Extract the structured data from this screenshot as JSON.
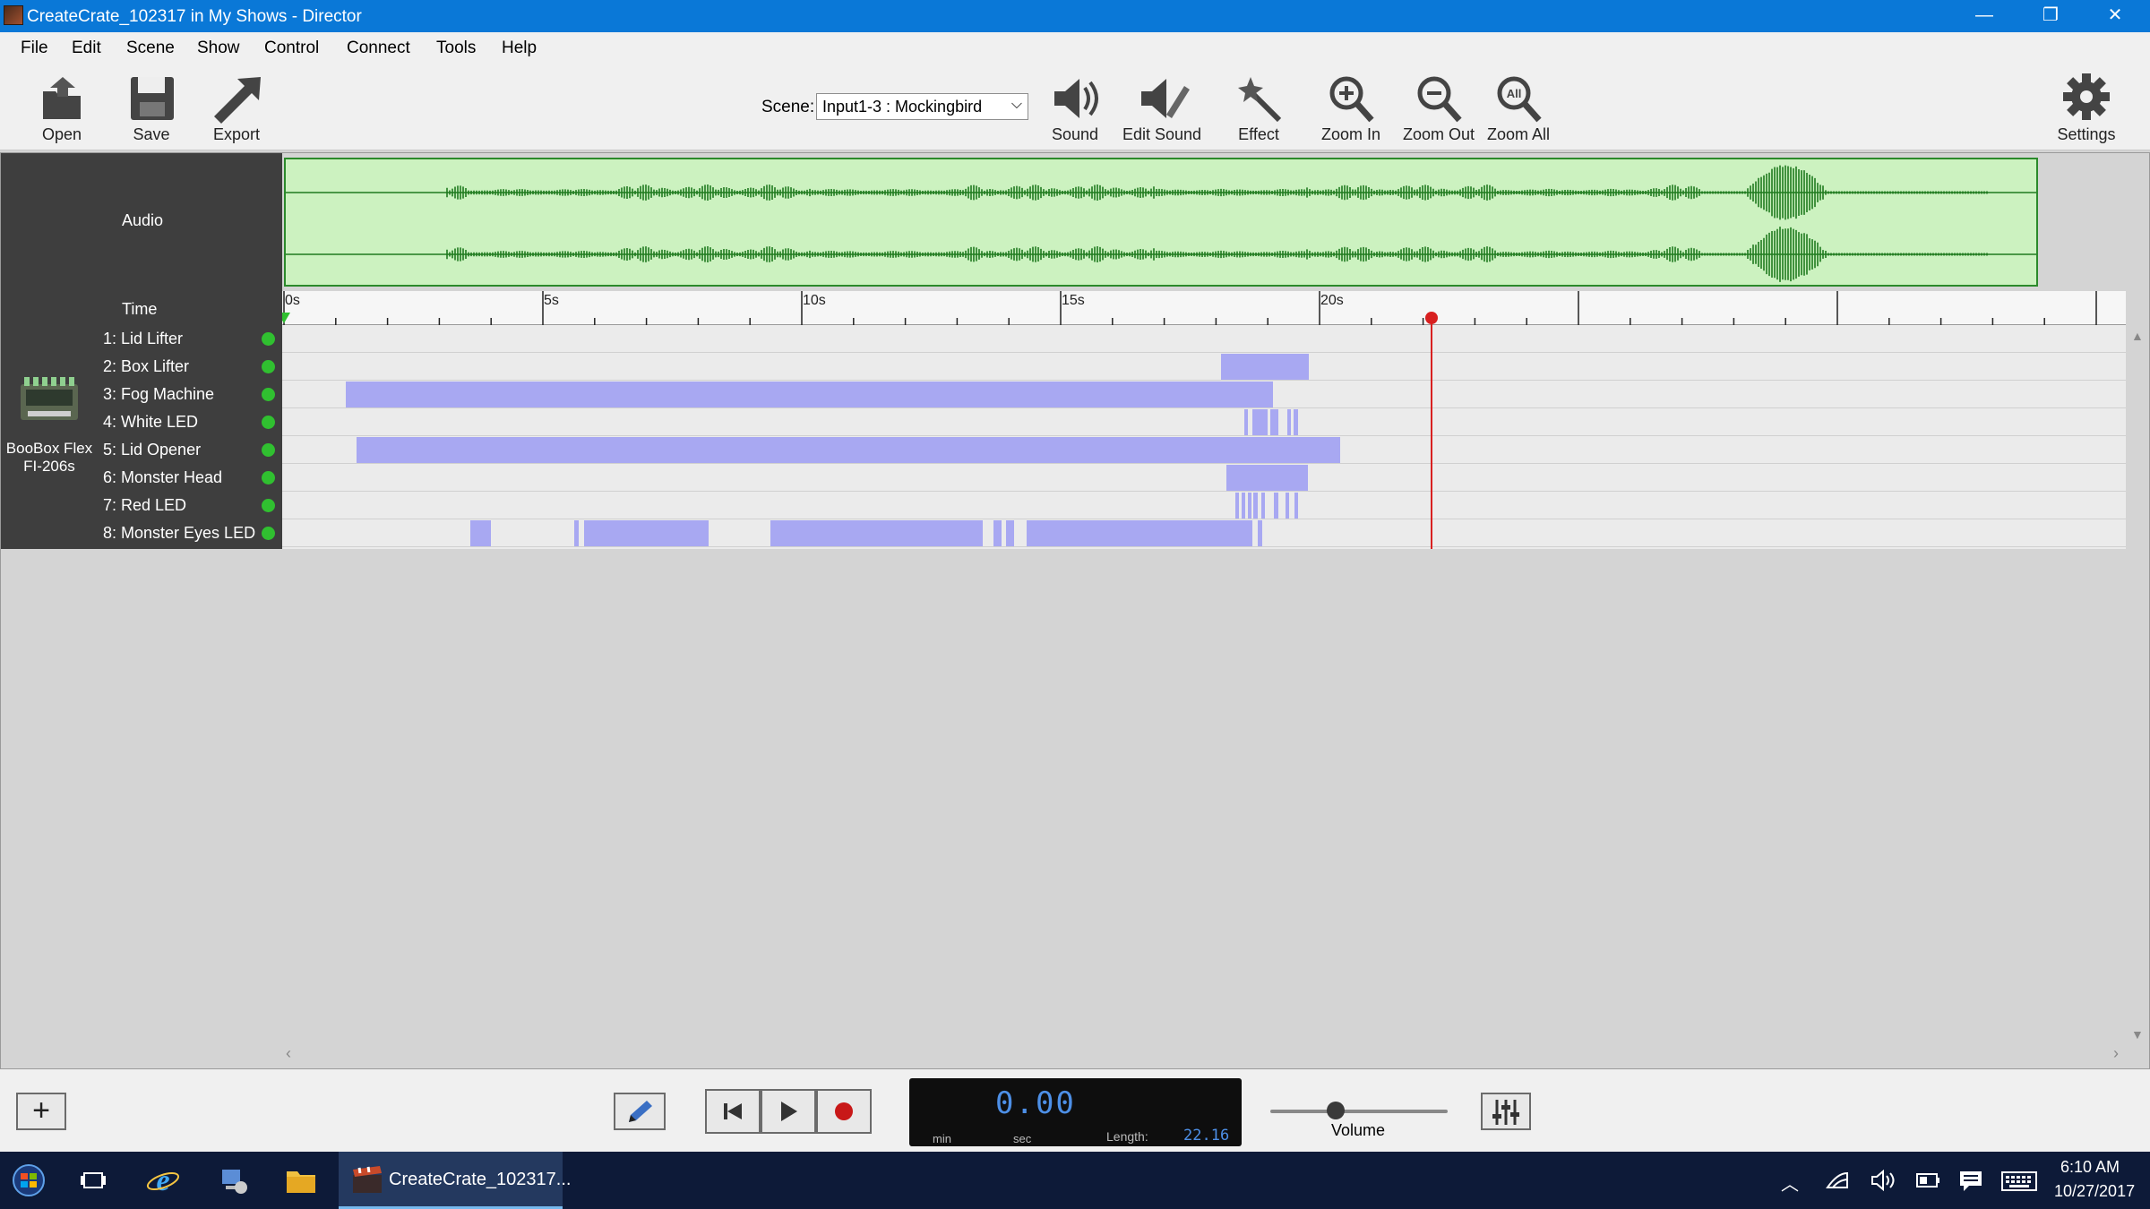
{
  "window": {
    "title": "CreateCrate_102317 in My Shows - Director",
    "minimize_glyph": "—",
    "restore_glyph": "❐",
    "close_glyph": "✕"
  },
  "menu": [
    "File",
    "Edit",
    "Scene",
    "Show",
    "Control",
    "Connect",
    "Tools",
    "Help"
  ],
  "toolbar": {
    "open": "Open",
    "save": "Save",
    "export": "Export",
    "scene_label": "Scene:",
    "scene_value": "Input1-3 : Mockingbird",
    "sound": "Sound",
    "edit_sound": "Edit Sound",
    "effect": "Effect",
    "zoom_in": "Zoom In",
    "zoom_out": "Zoom Out",
    "zoom_all": "Zoom All",
    "zoom_all_badge": "All",
    "settings": "Settings"
  },
  "timeline": {
    "audio_label": "Audio",
    "time_label": "Time",
    "ticks": [
      "0s",
      "5s",
      "10s",
      "15s",
      "20s"
    ],
    "length_seconds": 22.16,
    "playhead_seconds": 0.0
  },
  "device": {
    "name": "BooBox Flex FI-206s",
    "name_line1": "BooBox Flex",
    "name_line2": "FI-206s"
  },
  "channels": [
    {
      "label": "1: Lid Lifter",
      "status_color": "#30c030",
      "cues": []
    },
    {
      "label": "2: Box Lifter",
      "status_color": "#30c030",
      "cues": [
        [
          18.1,
          19.8
        ]
      ]
    },
    {
      "label": "3: Fog Machine",
      "status_color": "#30c030",
      "cues": [
        [
          1.2,
          19.1
        ]
      ]
    },
    {
      "label": "4: White LED",
      "status_color": "#30c030",
      "cues": [
        [
          18.55,
          18.62
        ],
        [
          18.7,
          19.0
        ],
        [
          19.05,
          19.2
        ],
        [
          19.38,
          19.45
        ],
        [
          19.5,
          19.58
        ]
      ]
    },
    {
      "label": "5: Lid Opener",
      "status_color": "#30c030",
      "cues": [
        [
          1.4,
          20.4
        ]
      ]
    },
    {
      "label": "6: Monster Head",
      "status_color": "#30c030",
      "cues": [
        [
          18.2,
          19.77
        ]
      ]
    },
    {
      "label": "7: Red LED",
      "status_color": "#30c030",
      "cues": [
        [
          18.38,
          18.45
        ],
        [
          18.5,
          18.56
        ],
        [
          18.62,
          18.68
        ],
        [
          18.72,
          18.8
        ],
        [
          18.88,
          18.95
        ],
        [
          19.12,
          19.2
        ],
        [
          19.35,
          19.42
        ],
        [
          19.52,
          19.58
        ]
      ]
    },
    {
      "label": "8: Monster Eyes LED",
      "status_color": "#30c030",
      "cues": [
        [
          3.6,
          4.0
        ],
        [
          5.6,
          5.7
        ],
        [
          5.8,
          8.2
        ],
        [
          9.4,
          13.5
        ],
        [
          13.7,
          13.85
        ],
        [
          13.95,
          14.1
        ],
        [
          14.35,
          18.7
        ],
        [
          18.8,
          18.9
        ]
      ]
    }
  ],
  "transport": {
    "time_value": "0.00",
    "min_label": "min",
    "sec_label": "sec",
    "length_label": "Length:",
    "length_value": "22.16",
    "volume_label": "Volume",
    "volume_level": 0.37
  },
  "taskbar": {
    "active_app": "CreateCrate_102317...",
    "time": "6:10 AM",
    "date": "10/27/2017"
  },
  "colors": {
    "titlebar": "#0a78d7",
    "cue": "#a8a8f2",
    "waveform": "#1f7a1f",
    "waveform_bg": "#ccf2c0",
    "playhead": "#d82020",
    "status_on": "#30c030"
  }
}
